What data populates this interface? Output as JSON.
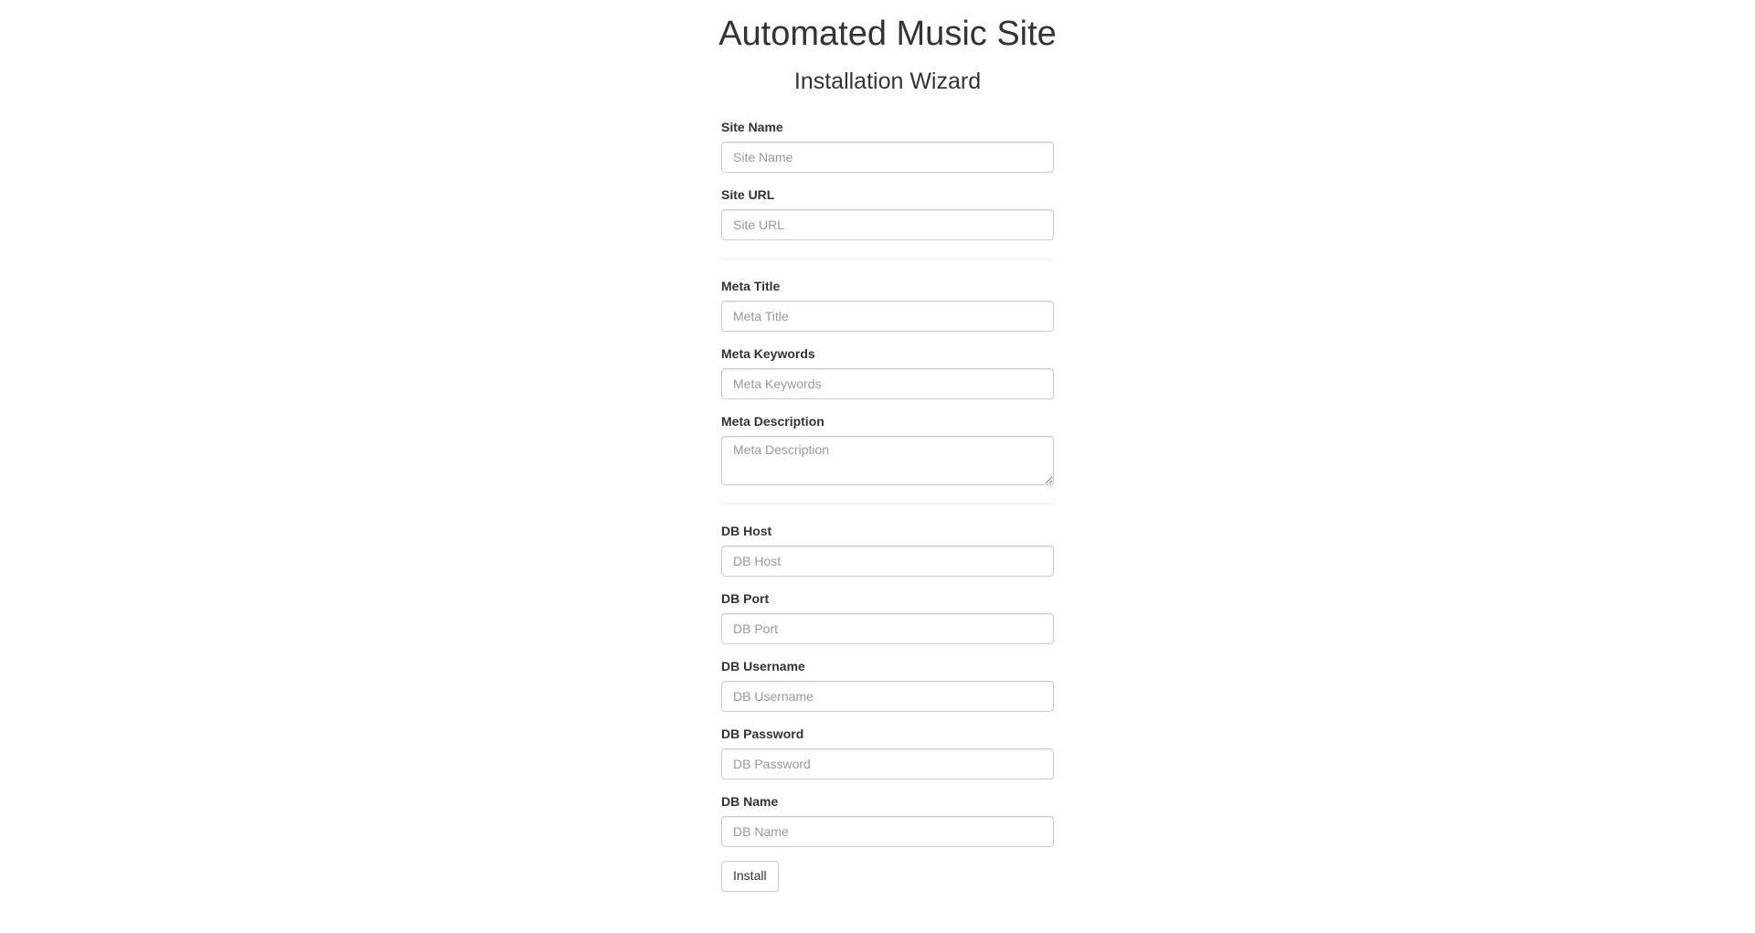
{
  "header": {
    "title": "Automated Music Site",
    "subtitle": "Installation Wizard"
  },
  "sections": {
    "site": [
      {
        "label": "Site Name",
        "placeholder": "Site Name",
        "value": ""
      },
      {
        "label": "Site URL",
        "placeholder": "Site URL",
        "value": ""
      }
    ],
    "meta": {
      "title": {
        "label": "Meta Title",
        "placeholder": "Meta Title",
        "value": ""
      },
      "keywords": {
        "label": "Meta Keywords",
        "placeholder": "Meta Keywords",
        "value": ""
      },
      "description": {
        "label": "Meta Description",
        "placeholder": "Meta Description",
        "value": ""
      }
    },
    "db": [
      {
        "label": "DB Host",
        "placeholder": "DB Host",
        "value": ""
      },
      {
        "label": "DB Port",
        "placeholder": "DB Port",
        "value": ""
      },
      {
        "label": "DB Username",
        "placeholder": "DB Username",
        "value": ""
      },
      {
        "label": "DB Password",
        "placeholder": "DB Password",
        "value": ""
      },
      {
        "label": "DB Name",
        "placeholder": "DB Name",
        "value": ""
      }
    ]
  },
  "actions": {
    "install_label": "Install"
  }
}
